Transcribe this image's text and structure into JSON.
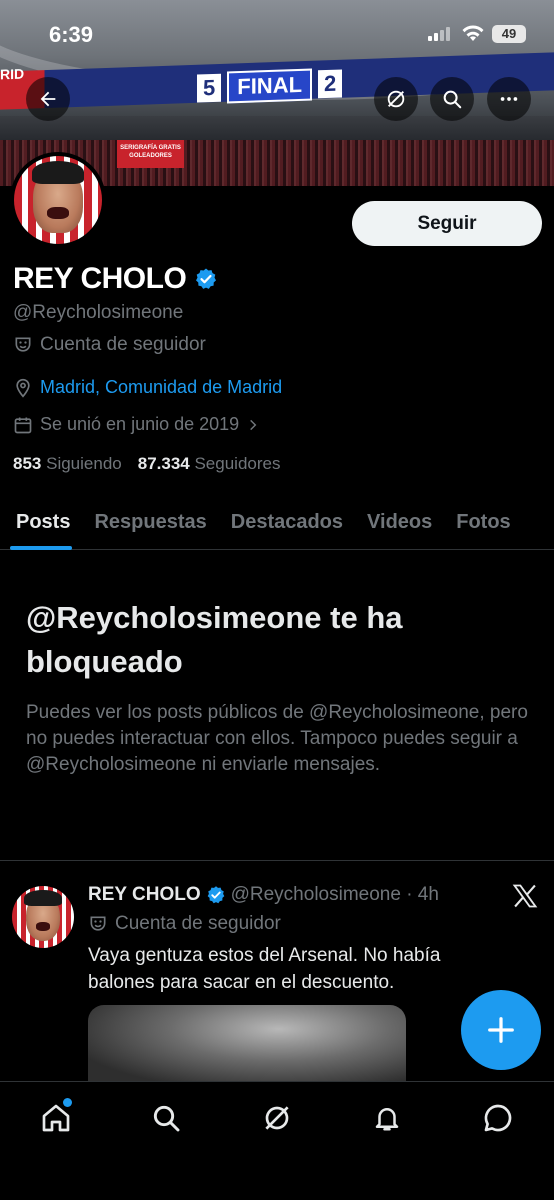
{
  "status_bar": {
    "time": "6:39",
    "battery": "49"
  },
  "banner": {
    "left_text": "RID",
    "score_left": "5",
    "final_label": "FINAL",
    "score_right": "2",
    "board_text": "SERIGRAFÍA GRATIS GOLEADORES"
  },
  "header_actions": {
    "back": "back-arrow-icon",
    "grok": "grok-icon",
    "search": "search-icon",
    "more": "more-icon"
  },
  "profile": {
    "follow_label": "Seguir",
    "display_name": "REY CHOLO",
    "handle": "@Reycholosimeone",
    "account_type": "Cuenta de seguidor",
    "location": "Madrid, Comunidad de Madrid",
    "joined": "Se unió en junio de 2019",
    "following_count": "853",
    "following_label": "Siguiendo",
    "followers_count": "87.334",
    "followers_label": "Seguidores"
  },
  "tabs": [
    "Posts",
    "Respuestas",
    "Destacados",
    "Videos",
    "Fotos"
  ],
  "blocked": {
    "title": "@Reycholosimeone te ha bloqueado",
    "text": "Puedes ver los posts públicos de @Reycholosimeone, pero no puedes interactuar con ellos. Tampoco puedes seguir a @Reycholosimeone ni enviarle mensajes."
  },
  "post": {
    "name": "REY CHOLO",
    "handle_time": "@Reycholosimeone · 4h",
    "account_type": "Cuenta de seguidor",
    "text": "Vaya gentuza estos del Arsenal. No había balones para sacar en el descuento."
  },
  "colors": {
    "accent": "#1d9bf0",
    "background": "#000000",
    "secondary_text": "#71767b"
  }
}
